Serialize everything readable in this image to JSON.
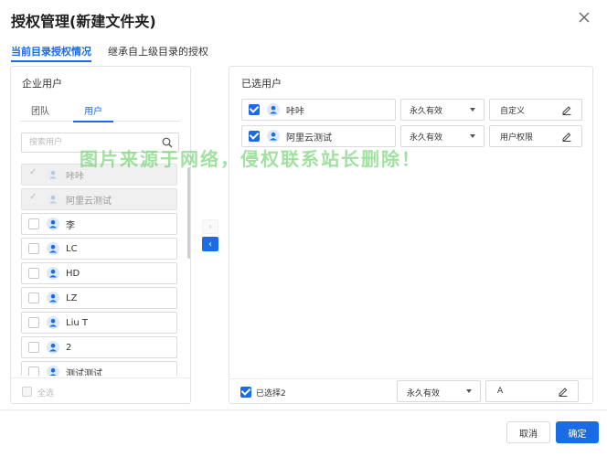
{
  "dialog": {
    "title": "授权管理(新建文件夹)"
  },
  "tabs": [
    {
      "label": "当前目录授权情况",
      "active": true
    },
    {
      "label": "继承自上级目录的授权",
      "active": false
    }
  ],
  "left_panel": {
    "header": "企业用户",
    "sub_tabs": [
      {
        "label": "团队",
        "active": false
      },
      {
        "label": "用户",
        "active": true
      }
    ],
    "search_placeholder": "搜索用户",
    "users": [
      {
        "name": "咔咔",
        "selected": true,
        "disabled": true
      },
      {
        "name": "阿里云测试",
        "selected": true,
        "disabled": true
      },
      {
        "name": "李",
        "selected": false,
        "disabled": false
      },
      {
        "name": "LC",
        "selected": false,
        "disabled": false
      },
      {
        "name": "HD",
        "selected": false,
        "disabled": false
      },
      {
        "name": "LZ",
        "selected": false,
        "disabled": false
      },
      {
        "name": "Liu T",
        "selected": false,
        "disabled": false
      },
      {
        "name": "2",
        "selected": false,
        "disabled": false
      },
      {
        "name": "测试测试",
        "selected": false,
        "disabled": false
      }
    ],
    "select_all_label": "全选"
  },
  "transfer": {
    "right_arrow": "›",
    "left_arrow": "‹"
  },
  "right_panel": {
    "header": "已选用户",
    "selected": [
      {
        "name": "咔咔",
        "validity": "永久有效",
        "role": "自定义",
        "checked": true
      },
      {
        "name": "阿里云测试",
        "validity": "永久有效",
        "role": "用户权限",
        "checked": true
      }
    ],
    "footer": {
      "selected_label": "已选择2",
      "validity": "永久有效",
      "role": "A"
    }
  },
  "buttons": {
    "cancel": "取消",
    "ok": "确定"
  },
  "watermark": "图片来源于网络，侵权联系站长删除！",
  "colors": {
    "accent": "#1a6ce6",
    "watermark": "#52c852"
  },
  "icons": {
    "close": "close-icon",
    "search": "search-icon",
    "user": "user-avatar-icon",
    "edit": "pencil-edit-icon"
  }
}
